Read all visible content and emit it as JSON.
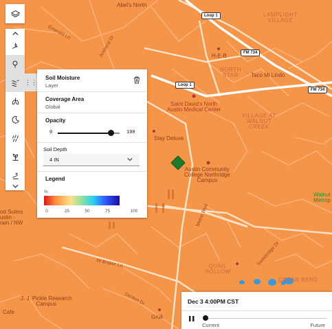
{
  "map": {
    "labels": {
      "abels_north": "Abel's North",
      "loop1_top": "Loop 1",
      "loop1_mid": "Loop 1",
      "lamplight_village": "LAMPLIGHT\nVILLAGE",
      "fm734_top": "FM 734",
      "fm734_right": "FM 734",
      "heb": "H-E-B",
      "north_star": "NORTH\nSTAR",
      "taco_mi_lindo": "Taco Mi Lindo",
      "st_davids": "Saint David's North\nAustin Medical Center",
      "village_walnut": "VILLAGE AT\nWALNUT\nCREEK",
      "stay_deluxe": "Stay Deluxe",
      "acc": "Austin Community\nCollege Northridge\nCampus",
      "walnut_metro": "Walnut\nMetrop",
      "od_suites": "od Suites\nustin -\nrain / NW",
      "metric_blvd": "Metric Blvd",
      "w_braker": "W Braker Ln",
      "quail_hollow": "QUAIL\nHOLLOW",
      "jj_pickle": "J. J. Pickle Research\nCampus",
      "denton_dr": "Denton Dr",
      "cafe": "Cafe",
      "gruli": "Gruli",
      "amherst": "Amherst Dr",
      "emerald": "Emerald Ln",
      "powder": "Powder Mill Rd",
      "parkside": "Sweetridge Dr",
      "cedarbend": "CEDAR BEND"
    },
    "colors": {
      "land": "#f5954a",
      "road_major": "#ffd9b8",
      "road_minor": "#fbb47e",
      "selected_point": "#1f7a2a",
      "water": "#3a9ad9"
    }
  },
  "toolbar": {
    "icons": [
      "layers-icon",
      "chevron-up-icon",
      "hand-drop-icon",
      "pin-icon",
      "wind-icon",
      "lungs-icon",
      "moon-rain-icon",
      "rain-icon",
      "plant-icon",
      "snowflake-icon",
      "chevron-down-icon"
    ],
    "drag_handle": "⋮⋮"
  },
  "layer_panel": {
    "title": "Soil Moisture",
    "subtitle": "Layer",
    "coverage_label": "Coverage Area",
    "coverage_value": "Global",
    "opacity_label": "Opacity",
    "opacity_min": "0",
    "opacity_max": "100",
    "opacity_value": 100,
    "soil_depth_label": "Soil Depth",
    "soil_depth_value": "4 IN",
    "legend_label": "Legend",
    "legend_unit": "%",
    "legend_ticks": [
      "0",
      "25",
      "50",
      "75",
      "100"
    ]
  },
  "playback": {
    "datetime": "Dec 3 4:00PM CST",
    "current_label": "Current",
    "future_label": "Future",
    "position": 0
  }
}
